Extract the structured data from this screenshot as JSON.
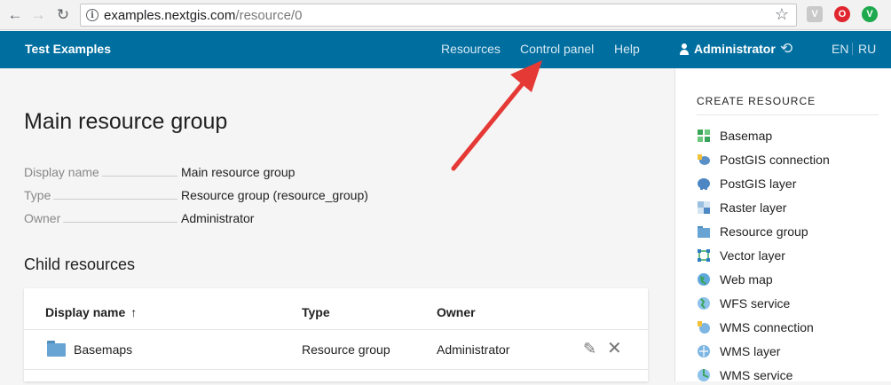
{
  "browser": {
    "back": "←",
    "forward": "→",
    "reload": "↻",
    "info": "i",
    "url_host": "examples.nextgis.com",
    "url_path": "/resource/0",
    "star": "☆",
    "ext1": "V",
    "ext2": "O",
    "ext3": "V"
  },
  "topnav": {
    "brand": "Test Examples",
    "links": [
      "Resources",
      "Control panel",
      "Help"
    ],
    "user": "Administrator",
    "logout": "⟲",
    "lang_en": "EN",
    "lang_ru": "RU"
  },
  "main": {
    "title": "Main resource group",
    "props": [
      {
        "label": "Display name",
        "value": "Main resource group"
      },
      {
        "label": "Type",
        "value": "Resource group (resource_group)"
      },
      {
        "label": "Owner",
        "value": "Administrator"
      }
    ],
    "subtitle": "Child resources",
    "table": {
      "headers": [
        "Display name",
        "Type",
        "Owner"
      ],
      "sort_icon": "↑",
      "rows": [
        {
          "name": "Basemaps",
          "type": "Resource group",
          "owner": "Administrator"
        }
      ],
      "edit": "✎",
      "delete": "✕"
    }
  },
  "sidebar": {
    "title": "CREATE RESOURCE",
    "items": [
      {
        "label": "Basemap",
        "icon": "basemap-icon"
      },
      {
        "label": "PostGIS connection",
        "icon": "postgis-connection-icon"
      },
      {
        "label": "PostGIS layer",
        "icon": "postgis-layer-icon"
      },
      {
        "label": "Raster layer",
        "icon": "raster-layer-icon"
      },
      {
        "label": "Resource group",
        "icon": "resource-group-icon"
      },
      {
        "label": "Vector layer",
        "icon": "vector-layer-icon"
      },
      {
        "label": "Web map",
        "icon": "web-map-icon"
      },
      {
        "label": "WFS service",
        "icon": "wfs-service-icon"
      },
      {
        "label": "WMS connection",
        "icon": "wms-connection-icon"
      },
      {
        "label": "WMS layer",
        "icon": "wms-layer-icon"
      },
      {
        "label": "WMS service",
        "icon": "wms-service-icon"
      }
    ]
  },
  "colors": {
    "header": "#006fa0",
    "arrow": "#e53935"
  }
}
